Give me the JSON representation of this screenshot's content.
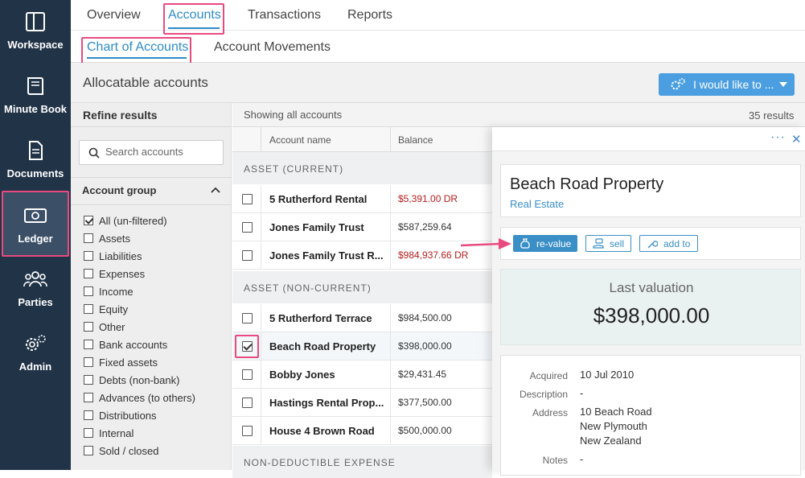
{
  "sidebar": {
    "items": [
      {
        "label": "Workspace",
        "icon": "workspace-icon"
      },
      {
        "label": "Minute Book",
        "icon": "book-icon"
      },
      {
        "label": "Documents",
        "icon": "document-icon"
      },
      {
        "label": "Ledger",
        "icon": "money-icon",
        "active": true
      },
      {
        "label": "Parties",
        "icon": "people-icon"
      },
      {
        "label": "Admin",
        "icon": "gears-icon"
      }
    ]
  },
  "tabs": [
    "Overview",
    "Accounts",
    "Transactions",
    "Reports"
  ],
  "subtabs": [
    "Chart of Accounts",
    "Account Movements"
  ],
  "page": {
    "title": "Allocatable accounts",
    "action_label": "I would like to ..."
  },
  "refine": {
    "title": "Refine results",
    "search_placeholder": "Search accounts",
    "group_title": "Account group",
    "filters": [
      "All (un-filtered)",
      "Assets",
      "Liabilities",
      "Expenses",
      "Income",
      "Equity",
      "Other",
      "Bank accounts",
      "Fixed assets",
      "Debts (non-bank)",
      "Advances (to others)",
      "Distributions",
      "Internal",
      "Sold / closed"
    ]
  },
  "list": {
    "showing": "Showing all accounts",
    "results": "35 results",
    "col_name": "Account name",
    "col_balance": "Balance",
    "sections": [
      "ASSET (CURRENT)",
      "ASSET (NON-CURRENT)",
      "NON-DEDUCTIBLE EXPENSE"
    ],
    "rows": [
      {
        "name": "5 Rutherford Rental",
        "balance": "$5,391.00",
        "dr": "DR"
      },
      {
        "name": "Jones Family Trust",
        "balance": "$587,259.64",
        "dr": ""
      },
      {
        "name": "Jones Family Trust R...",
        "balance": "$984,937.66",
        "dr": "DR"
      },
      {
        "name": "5 Rutherford Terrace",
        "balance": "$984,500.00",
        "dr": ""
      },
      {
        "name": "Beach Road Property",
        "balance": "$398,000.00",
        "dr": ""
      },
      {
        "name": "Bobby Jones",
        "balance": "$29,431.45",
        "dr": ""
      },
      {
        "name": "Hastings Rental Prop...",
        "balance": "$377,500.00",
        "dr": ""
      },
      {
        "name": "House 4 Brown Road",
        "balance": "$500,000.00",
        "dr": ""
      }
    ]
  },
  "panel": {
    "dots": "···",
    "close": "✕",
    "title": "Beach Road Property",
    "category": "Real Estate",
    "buttons": [
      "re-value",
      "sell",
      "add to"
    ],
    "valuation_label": "Last valuation",
    "valuation_value": "$398,000.00",
    "details": {
      "acquired_label": "Acquired",
      "acquired": "10 Jul 2010",
      "description_label": "Description",
      "description": "-",
      "address_label": "Address",
      "address": [
        "10 Beach Road",
        "New Plymouth",
        "New Zealand"
      ],
      "notes_label": "Notes",
      "notes": "-"
    }
  },
  "colors": {
    "sidebar": "#213347",
    "accent": "#2e8bc9",
    "highlight": "#e84a7f",
    "negative": "#b71c1c"
  }
}
